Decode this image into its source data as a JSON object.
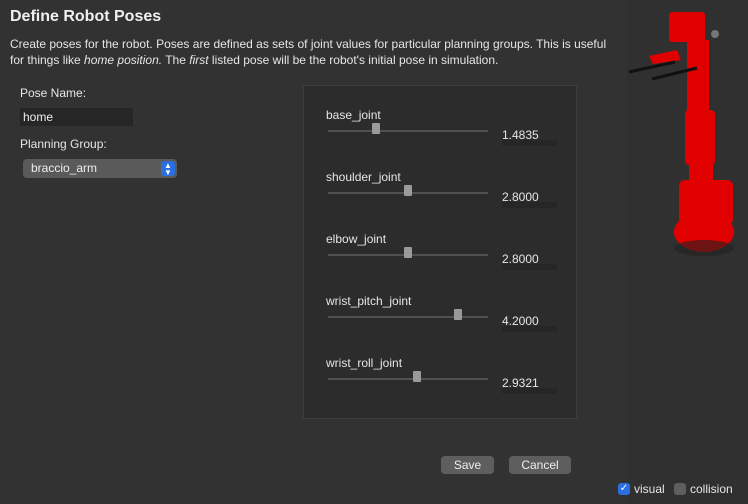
{
  "title": "Define Robot Poses",
  "description": {
    "part1": "Create poses for the robot. Poses are defined as sets of joint values for particular planning groups. This is useful for things like ",
    "em1": "home position.",
    "part2": " The ",
    "em2": "first",
    "part3": " listed pose will be the robot's initial pose in simulation."
  },
  "pose_name": {
    "label": "Pose Name:",
    "value": "home"
  },
  "planning_group": {
    "label": "Planning Group:",
    "value": "braccio_arm"
  },
  "joints": [
    {
      "name": "base_joint",
      "value": "1.4835",
      "slider_fraction": 0.29
    },
    {
      "name": "shoulder_joint",
      "value": "2.8000",
      "slider_fraction": 0.5
    },
    {
      "name": "elbow_joint",
      "value": "2.8000",
      "slider_fraction": 0.5
    },
    {
      "name": "wrist_pitch_joint",
      "value": "4.2000",
      "slider_fraction": 0.83
    },
    {
      "name": "wrist_roll_joint",
      "value": "2.9321",
      "slider_fraction": 0.56
    }
  ],
  "buttons": {
    "save": "Save",
    "cancel": "Cancel"
  },
  "viewer": {
    "visual_label": "visual",
    "visual_checked": true,
    "collision_label": "collision",
    "collision_checked": false
  }
}
